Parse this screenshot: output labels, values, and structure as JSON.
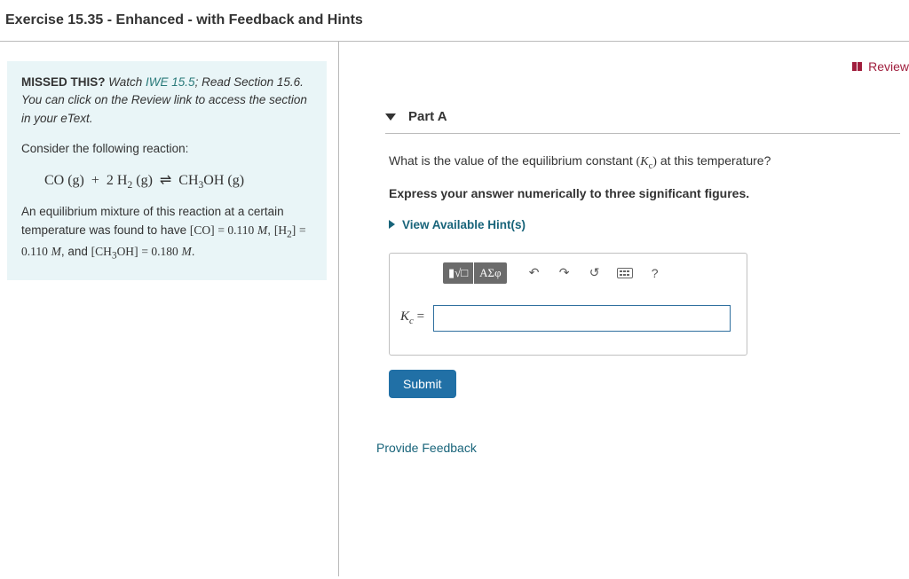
{
  "header": {
    "exercise_title": "Exercise 15.35 - Enhanced - with Feedback and Hints"
  },
  "review": {
    "label": "Review"
  },
  "problem": {
    "missed_prefix": "MISSED THIS?",
    "missed_watch": "Watch ",
    "iwe_link": "IWE 15.5",
    "missed_rest": "; Read Section 15.6. You can click on the Review link to access the section in your eText.",
    "consider": "Consider the following reaction:",
    "reaction_html": "CO (g)  +  2 H₂ (g)  ⇌  CH₃OH (g)",
    "desc_1": "An equilibrium mixture of this reaction at a certain temperature was found to have ",
    "c_CO_label": "[CO] = 0.110 M",
    "desc_2": ", ",
    "c_H2_label": "[H₂] = 0.110 M",
    "desc_3": ", and ",
    "c_CH3OH_label": "[CH₃OH] = 0.180 M",
    "desc_4": "."
  },
  "part": {
    "label": "Part A",
    "question_pre": "What is the value of the equilibrium constant ",
    "kc_symbol": "(Kc)",
    "question_post": " at this temperature?",
    "instruction": "Express your answer numerically to three significant figures.",
    "hints_label": "View Available Hint(s)",
    "answer_prefix": "Kc =",
    "submit_label": "Submit"
  },
  "toolbar": {
    "templates_tip": "Templates",
    "symbols_label": "ΑΣφ",
    "undo_tip": "↶",
    "redo_tip": "↷",
    "reset_tip": "↺",
    "keyboard_tip": "Keyboard",
    "help_tip": "?"
  },
  "footer": {
    "feedback_label": "Provide Feedback"
  }
}
